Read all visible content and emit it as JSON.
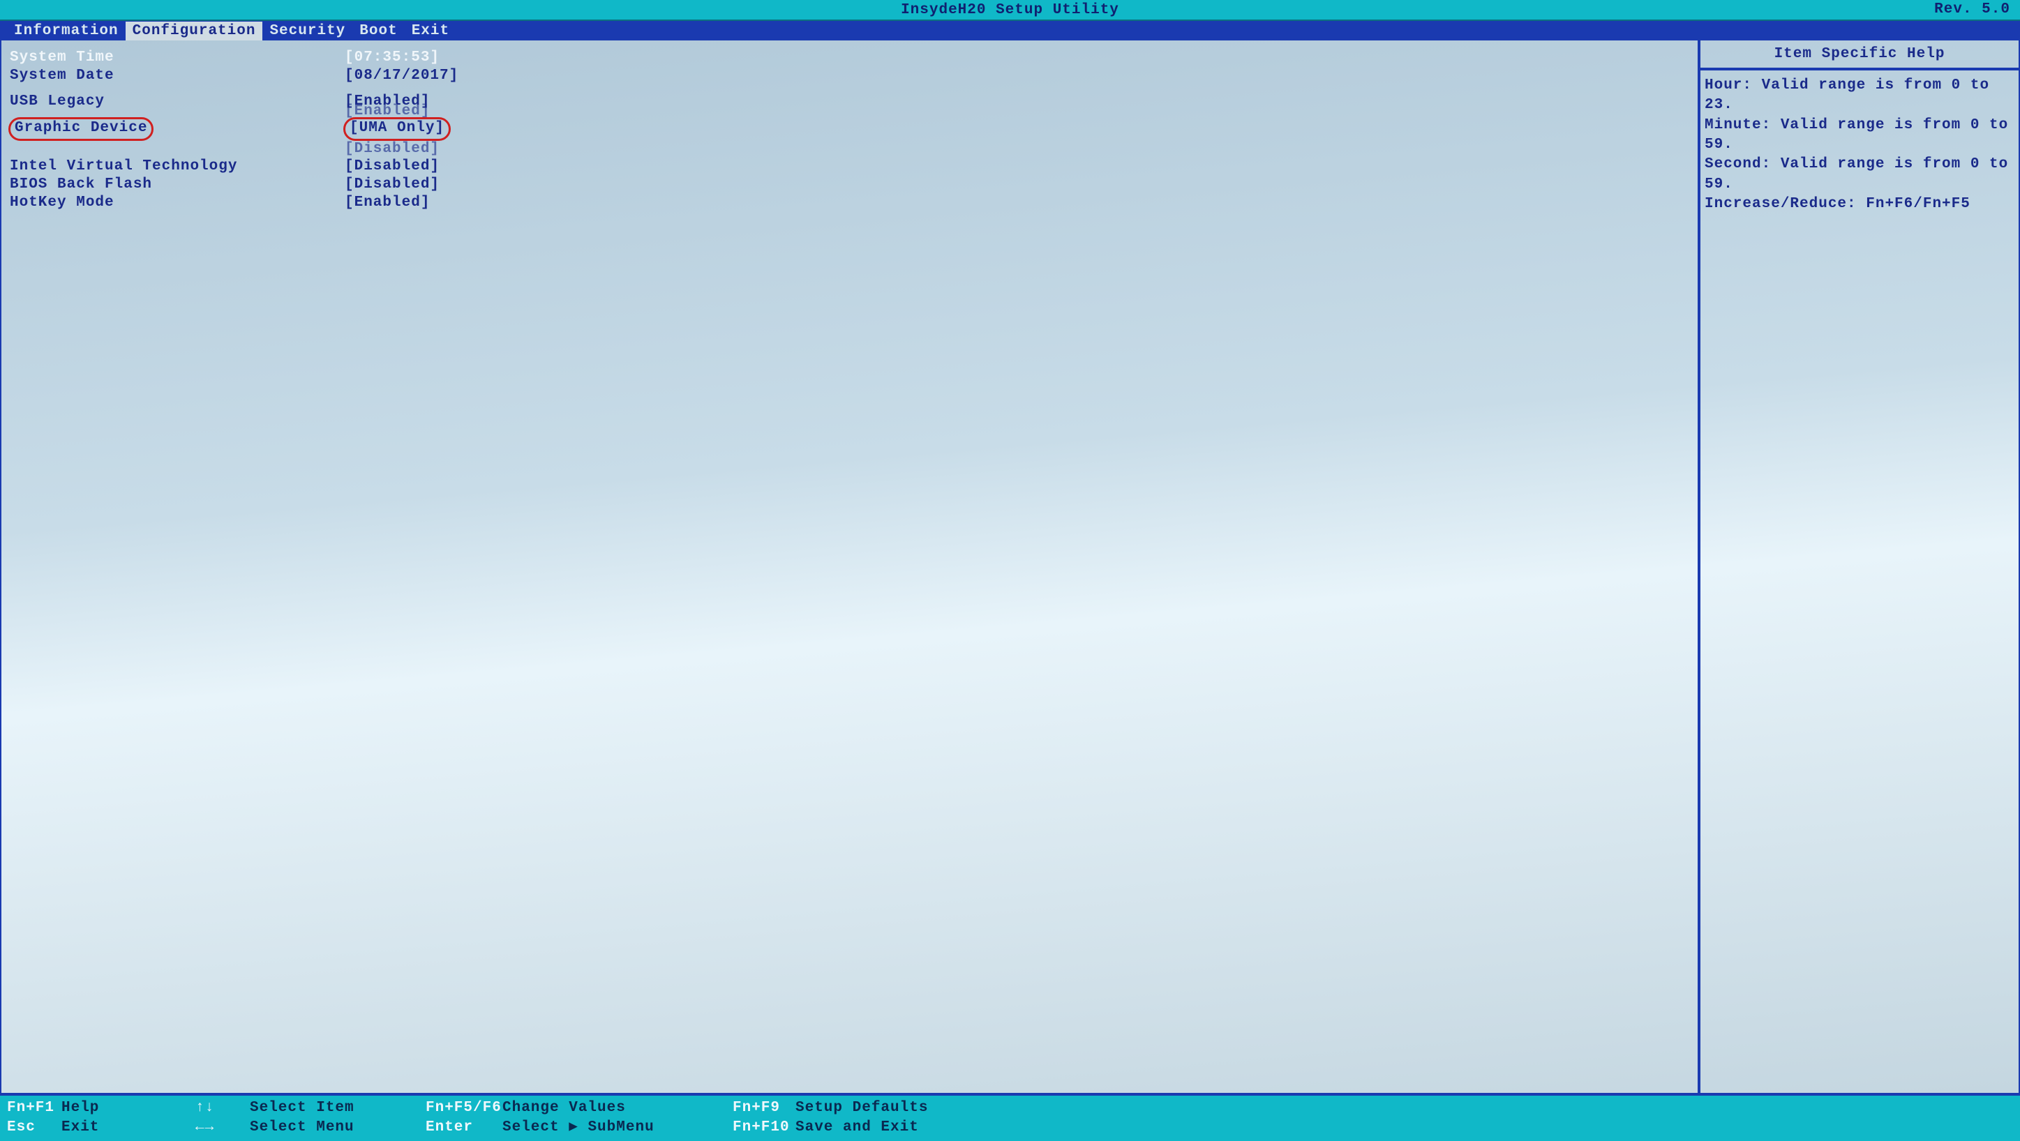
{
  "title": "InsydeH20 Setup Utility",
  "revision": "Rev. 5.0",
  "menu": {
    "items": [
      "Information",
      "Configuration",
      "Security",
      "Boot",
      "Exit"
    ],
    "active": "Configuration"
  },
  "settings": {
    "system_time": {
      "label": "System Time",
      "value": "[07:35:53]"
    },
    "system_date": {
      "label": "System Date",
      "value": "[08/17/2017]"
    },
    "usb_legacy": {
      "label": "USB Legacy",
      "value": "[Enabled]"
    },
    "hidden_row": {
      "label": "",
      "value": "[Enabled]"
    },
    "graphic_device": {
      "label": "Graphic Device",
      "value": "[UMA Only]"
    },
    "hidden_row2": {
      "label": "",
      "value": "[Disabled]"
    },
    "intel_vt": {
      "label": "Intel Virtual Technology",
      "value": "[Disabled]"
    },
    "bios_back_flash": {
      "label": "BIOS Back Flash",
      "value": "[Disabled]"
    },
    "hotkey_mode": {
      "label": "HotKey Mode",
      "value": "[Enabled]"
    }
  },
  "help": {
    "title": "Item Specific Help",
    "lines": [
      "Hour: Valid range is from 0 to 23.",
      "Minute: Valid range is from 0 to 59.",
      "Second: Valid range is from 0 to 59.",
      "",
      "Increase/Reduce: Fn+F6/Fn+F5"
    ]
  },
  "footer": {
    "r1c1k": "Fn+F1",
    "r1c1l": "Help",
    "r1c2k": "↑↓",
    "r1c2l": "Select Item",
    "r1c3k": "Fn+F5/F6",
    "r1c3l": "Change Values",
    "r1c4k": "Fn+F9",
    "r1c4l": "Setup Defaults",
    "r2c1k": "Esc",
    "r2c1l": "Exit",
    "r2c2k": "←→",
    "r2c2l": "Select Menu",
    "r2c3k": "Enter",
    "r2c3l": "Select ▶ SubMenu",
    "r2c4k": "Fn+F10",
    "r2c4l": "Save and Exit"
  }
}
